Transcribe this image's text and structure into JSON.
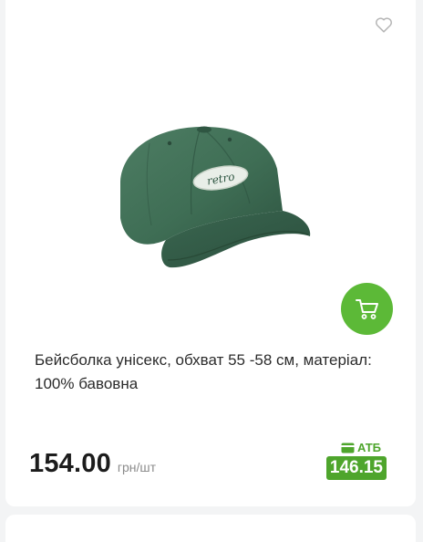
{
  "product": {
    "title": "Бейсболка унісекс, обхват 55 -58 см, матеріал: 100% бавовна",
    "price": "154.00",
    "unit": "грн/шт",
    "card_price_label": "АТБ",
    "card_price": "146.15",
    "image_text": "retro"
  },
  "icons": {
    "favorite": "heart-outline-icon",
    "cart": "shopping-cart-icon",
    "card": "wallet-icon"
  },
  "colors": {
    "accent_green": "#5cb937",
    "atb_green": "#4ea52c",
    "cap_green": "#3d6a52"
  }
}
